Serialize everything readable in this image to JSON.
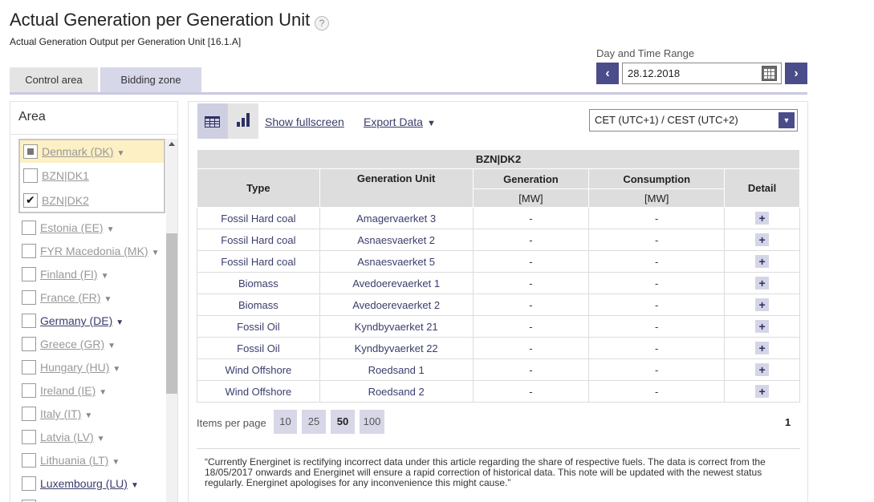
{
  "header": {
    "title": "Actual Generation per Generation Unit",
    "help_icon": "?",
    "subtitle": "Actual Generation Output per Generation Unit [16.1.A]"
  },
  "tabs": [
    {
      "label": "Control area",
      "active": false
    },
    {
      "label": "Bidding zone",
      "active": true
    }
  ],
  "date_range": {
    "label": "Day and Time Range",
    "value": "28.12.2018",
    "prev_icon": "chevron-left-icon",
    "next_icon": "chevron-right-icon",
    "calendar_icon": "calendar-icon"
  },
  "area": {
    "title": "Area",
    "items": [
      {
        "label": "Denmark (DK)",
        "state": "partial",
        "expandable": true
      },
      {
        "label": "BZN|DK1",
        "state": "unchecked",
        "expandable": false
      },
      {
        "label": "BZN|DK2",
        "state": "checked",
        "expandable": false
      },
      {
        "label": "Estonia (EE)",
        "state": "unchecked",
        "expandable": true
      },
      {
        "label": "FYR Macedonia (MK)",
        "state": "unchecked",
        "expandable": true
      },
      {
        "label": "Finland (FI)",
        "state": "unchecked",
        "expandable": true
      },
      {
        "label": "France (FR)",
        "state": "unchecked",
        "expandable": true
      },
      {
        "label": "Germany (DE)",
        "state": "unchecked",
        "expandable": true
      },
      {
        "label": "Greece (GR)",
        "state": "unchecked",
        "expandable": true
      },
      {
        "label": "Hungary (HU)",
        "state": "unchecked",
        "expandable": true
      },
      {
        "label": "Ireland (IE)",
        "state": "unchecked",
        "expandable": true
      },
      {
        "label": "Italy (IT)",
        "state": "unchecked",
        "expandable": true
      },
      {
        "label": "Latvia (LV)",
        "state": "unchecked",
        "expandable": true
      },
      {
        "label": "Lithuania (LT)",
        "state": "unchecked",
        "expandable": true
      },
      {
        "label": "Luxembourg (LU)",
        "state": "unchecked",
        "expandable": true
      }
    ]
  },
  "toolbar": {
    "show_fullscreen": "Show fullscreen",
    "export_data": "Export Data",
    "timezone": "CET (UTC+1) / CEST (UTC+2)"
  },
  "table": {
    "zone_header": "BZN|DK2",
    "headers": {
      "type": "Type",
      "generation_unit": "Generation Unit",
      "generation": "Generation",
      "consumption": "Consumption",
      "detail": "Detail",
      "generation_unit_mw": "[MW]",
      "consumption_unit_mw": "[MW]"
    },
    "rows": [
      {
        "type": "Fossil Hard coal",
        "unit": "Amagervaerket 3",
        "generation": "-",
        "consumption": "-",
        "detail": "+"
      },
      {
        "type": "Fossil Hard coal",
        "unit": "Asnaesvaerket 2",
        "generation": "-",
        "consumption": "-",
        "detail": "+"
      },
      {
        "type": "Fossil Hard coal",
        "unit": "Asnaesvaerket 5",
        "generation": "-",
        "consumption": "-",
        "detail": "+"
      },
      {
        "type": "Biomass",
        "unit": "Avedoerevaerket 1",
        "generation": "-",
        "consumption": "-",
        "detail": "+"
      },
      {
        "type": "Biomass",
        "unit": "Avedoerevaerket 2",
        "generation": "-",
        "consumption": "-",
        "detail": "+"
      },
      {
        "type": "Fossil Oil",
        "unit": "Kyndbyvaerket 21",
        "generation": "-",
        "consumption": "-",
        "detail": "+"
      },
      {
        "type": "Fossil Oil",
        "unit": "Kyndbyvaerket 22",
        "generation": "-",
        "consumption": "-",
        "detail": "+"
      },
      {
        "type": "Wind Offshore",
        "unit": "Roedsand 1",
        "generation": "-",
        "consumption": "-",
        "detail": "+"
      },
      {
        "type": "Wind Offshore",
        "unit": "Roedsand 2",
        "generation": "-",
        "consumption": "-",
        "detail": "+"
      }
    ]
  },
  "pagination": {
    "items_per_page_label": "Items per page",
    "options": [
      "10",
      "25",
      "50",
      "100"
    ],
    "selected": "50",
    "current_page": "1"
  },
  "note": "“Currently Energinet is rectifying incorrect data under this article regarding the share of respective fuels. The data is correct from the 18/05/2017 onwards and Energinet will ensure a rapid correction of historical data. This note will be updated with the newest status regularly. Energinet apologises for any inconvenience this might cause.”"
}
